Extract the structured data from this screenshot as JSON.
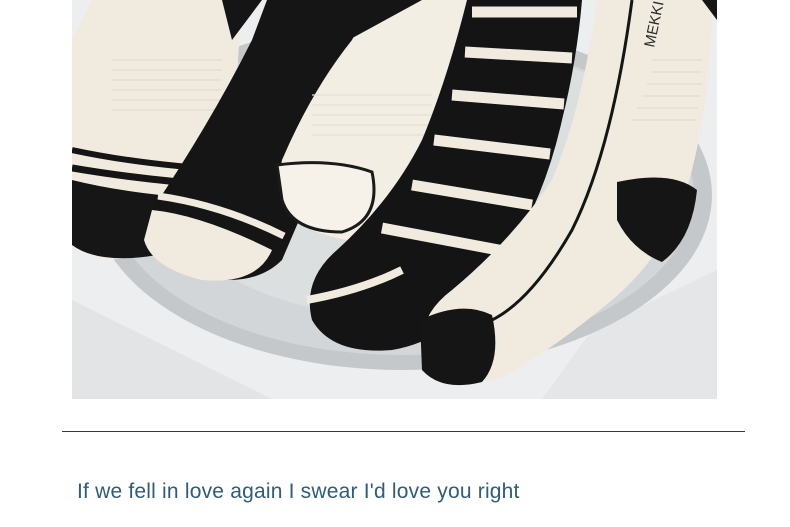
{
  "photo": {
    "subject": "five socks on a round metal tray",
    "sock_print": "MEKKI",
    "colors": {
      "cream": "#f1ebdf",
      "black": "#151515",
      "tray": "#c9ccce",
      "floor": "#e9ebed"
    }
  },
  "caption": {
    "text": "If we fell in love again I swear I'd love you right"
  }
}
